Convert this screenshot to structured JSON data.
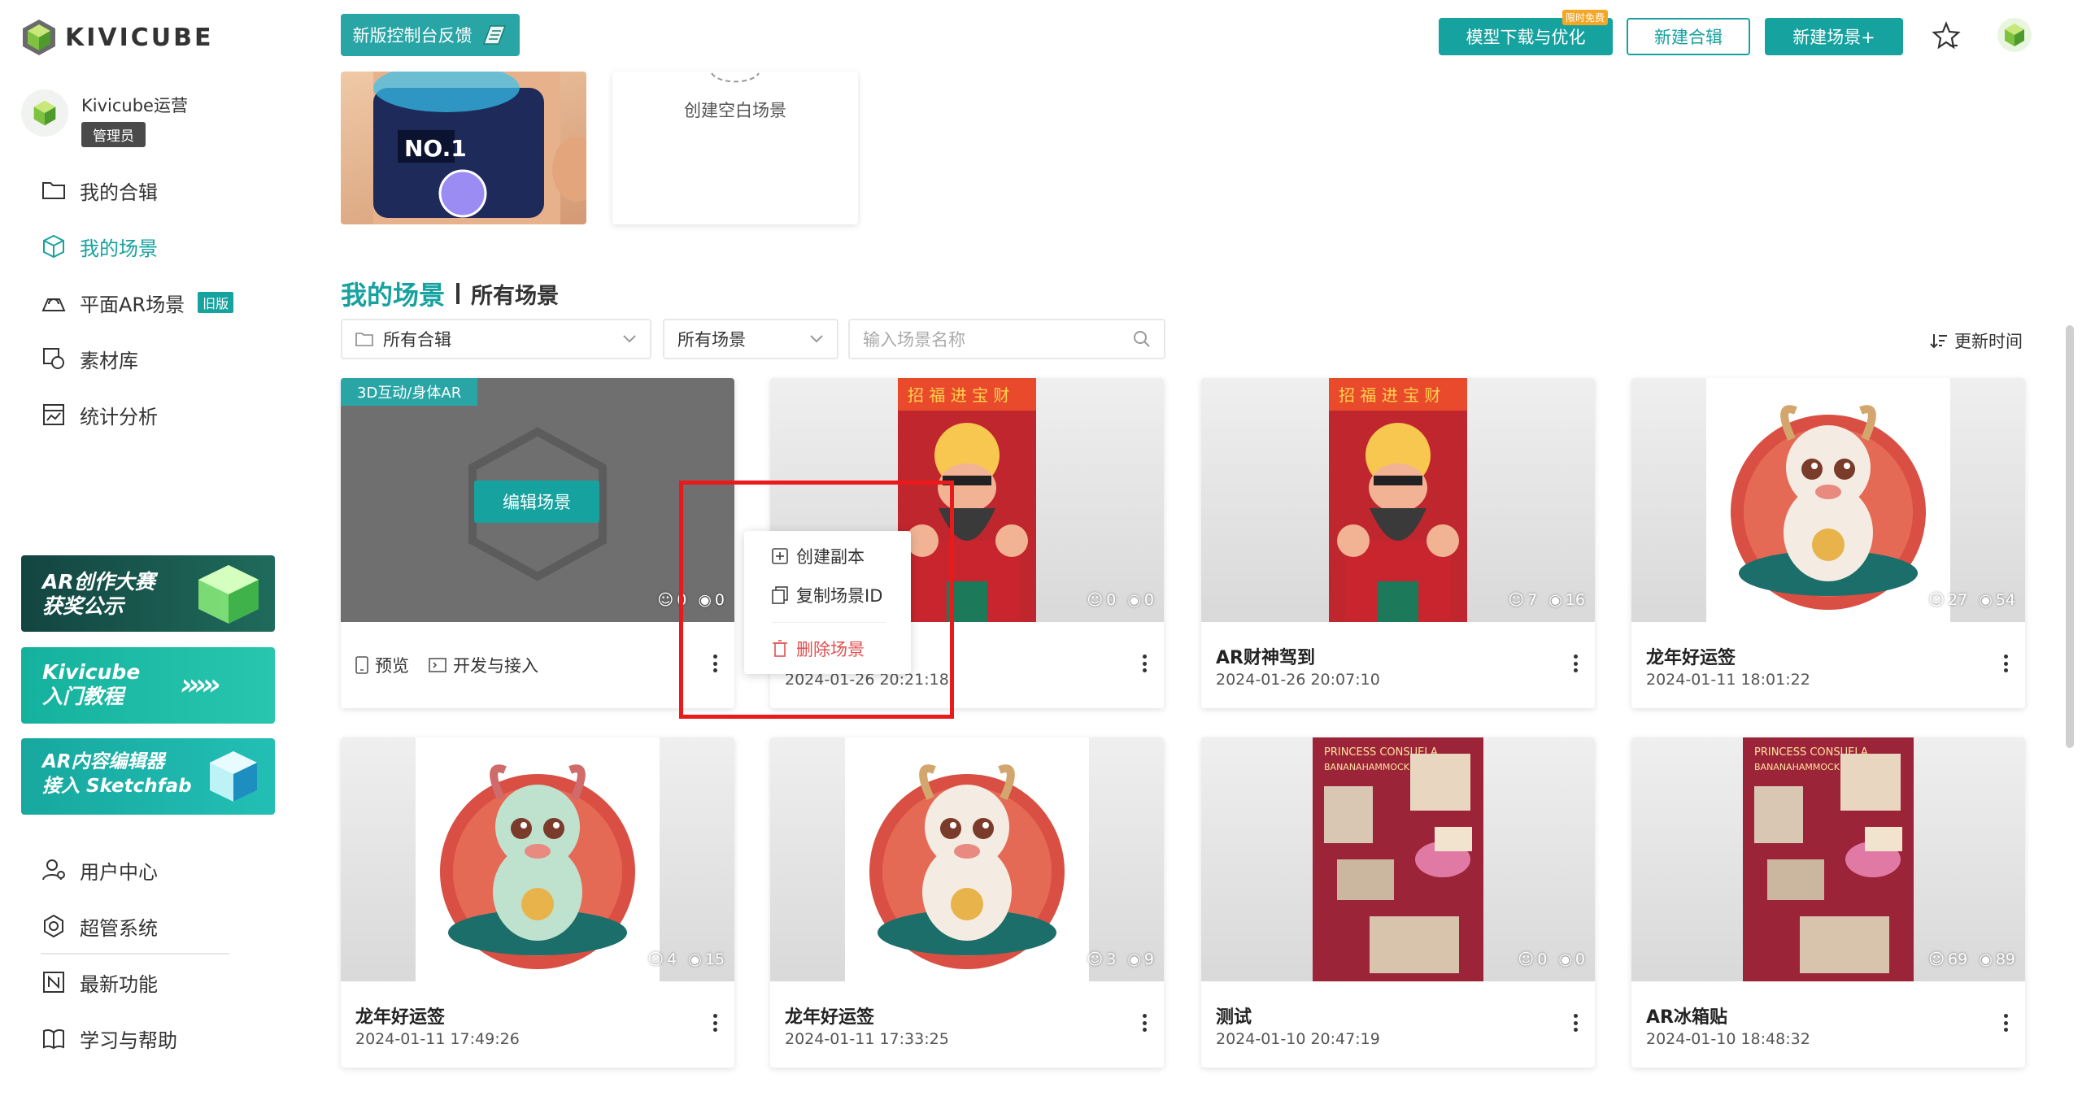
{
  "app": {
    "logo_text": "KIVICUBE"
  },
  "header": {
    "feedback_label": "新版控制台反馈",
    "model_download_label": "模型下载与优化",
    "limited_free_badge": "限时免费",
    "new_collection_label": "新建合辑",
    "new_scene_label": "新建场景+"
  },
  "user": {
    "name": "Kivicube运营",
    "role": "管理员"
  },
  "sidebar": {
    "nav": [
      {
        "label": "我的合辑",
        "icon": "folder-icon"
      },
      {
        "label": "我的场景",
        "icon": "cube-icon",
        "active": true
      },
      {
        "label": "平面AR场景",
        "icon": "ar-plane-icon",
        "badge": "旧版"
      },
      {
        "label": "素材库",
        "icon": "material-icon"
      },
      {
        "label": "统计分析",
        "icon": "chart-icon"
      }
    ],
    "banners": [
      {
        "line1": "AR创作大赛",
        "line2": "获奖公示",
        "color": "#1d5a50"
      },
      {
        "line1": "Kivicube",
        "line2": "入门教程",
        "color": "#1fb5a0"
      },
      {
        "line1": "AR内容编辑器",
        "line2": "接入 Sketchfab",
        "color": "#17a8a3"
      }
    ],
    "bottom_nav": [
      {
        "label": "用户中心",
        "icon": "user-icon"
      },
      {
        "label": "超管系统",
        "icon": "settings-icon"
      },
      {
        "label": "最新功能",
        "icon": "news-icon"
      },
      {
        "label": "学习与帮助",
        "icon": "book-icon"
      }
    ]
  },
  "top_cards": {
    "blank_scene_label": "创建空白场景"
  },
  "section": {
    "title": "我的场景",
    "subtitle": "所有场景"
  },
  "filters": {
    "collection": "所有合辑",
    "scene_type": "所有场景",
    "search_placeholder": "输入场景名称",
    "sort_label": "更新时间"
  },
  "first_card": {
    "type_badge": "3D互动/身体AR",
    "edit_label": "编辑场景",
    "preview_label": "预览",
    "develop_label": "开发与接入",
    "users": "0",
    "views": "0"
  },
  "cards": [
    {
      "name": "",
      "date": "2024-01-26 20:21:18",
      "users": "0",
      "views": "0",
      "thumb": "god"
    },
    {
      "name": "AR财神驾到",
      "date": "2024-01-26 20:07:10",
      "users": "7",
      "views": "16",
      "thumb": "god"
    },
    {
      "name": "龙年好运签",
      "date": "2024-01-11 18:01:22",
      "users": "27",
      "views": "54",
      "thumb": "dragon-white"
    },
    {
      "name": "龙年好运签",
      "date": "2024-01-11 17:49:26",
      "users": "4",
      "views": "15",
      "thumb": "dragon-green"
    },
    {
      "name": "龙年好运签",
      "date": "2024-01-11 17:33:25",
      "users": "3",
      "views": "9",
      "thumb": "dragon-white"
    },
    {
      "name": "测试",
      "date": "2024-01-10 20:47:19",
      "users": "0",
      "views": "0",
      "thumb": "poster"
    },
    {
      "name": "AR冰箱贴",
      "date": "2024-01-10 18:48:32",
      "users": "69",
      "views": "89",
      "thumb": "poster"
    }
  ],
  "popover": {
    "duplicate_label": "创建副本",
    "copy_id_label": "复制场景ID",
    "delete_label": "删除场景"
  },
  "colors": {
    "accent": "#16a29f",
    "danger": "#e05050",
    "highlight": "#ea1a1a"
  }
}
